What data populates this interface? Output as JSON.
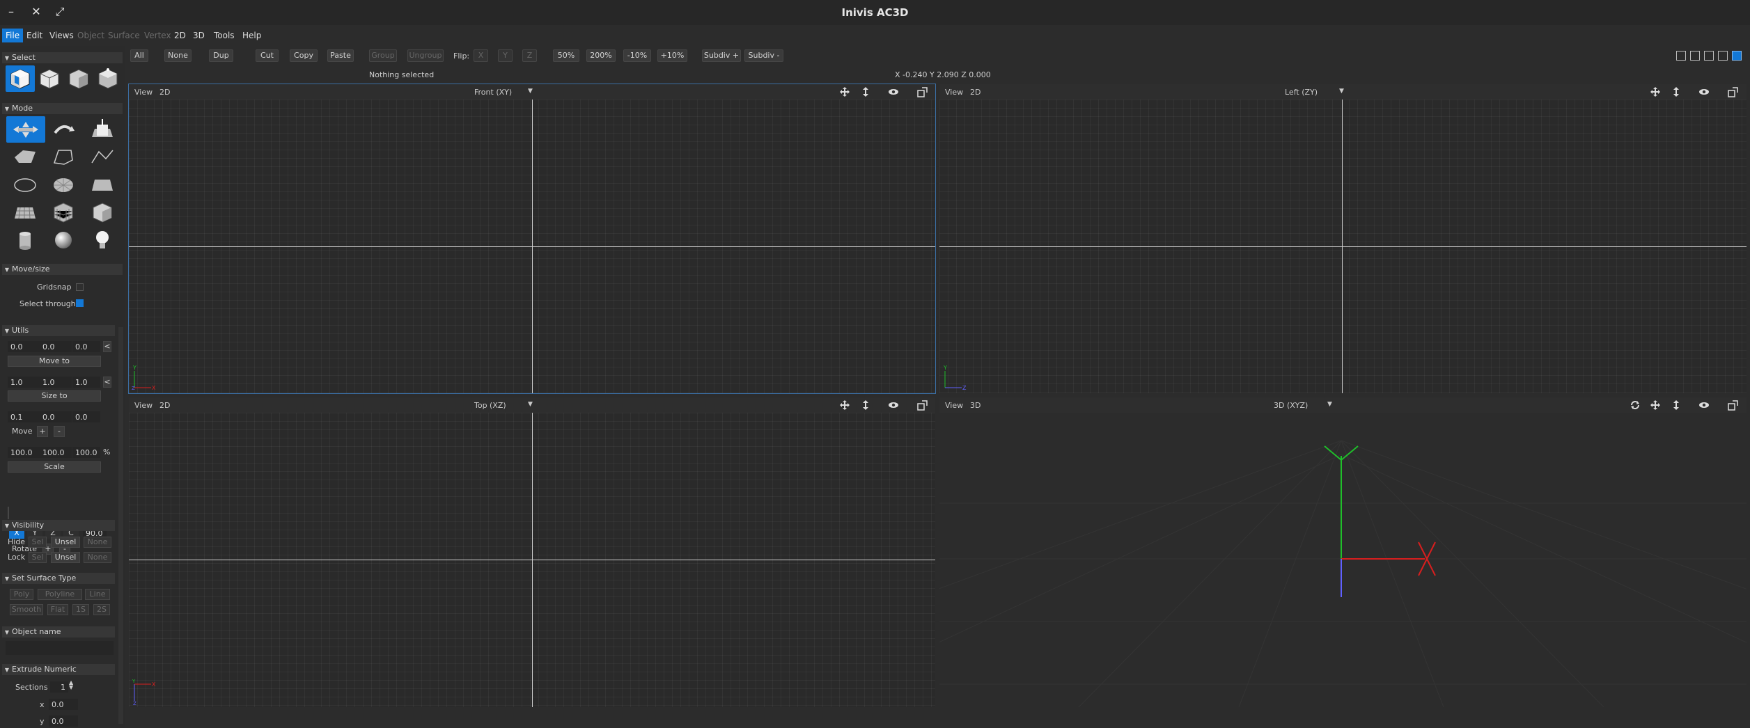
{
  "window": {
    "title": "Inivis AC3D",
    "minimize": "–",
    "close": "✕",
    "maximize": "⤢"
  },
  "menu": {
    "items": [
      {
        "label": "File",
        "state": "active"
      },
      {
        "label": "Edit",
        "state": "normal"
      },
      {
        "label": "Views",
        "state": "normal"
      },
      {
        "label": "Object",
        "state": "disabled"
      },
      {
        "label": "Surface",
        "state": "disabled"
      },
      {
        "label": "Vertex",
        "state": "disabled"
      },
      {
        "label": "2D",
        "state": "normal"
      },
      {
        "label": "3D",
        "state": "normal"
      },
      {
        "label": "Tools",
        "state": "normal"
      },
      {
        "label": "Help",
        "state": "normal"
      }
    ]
  },
  "toolbar": {
    "all": "All",
    "none": "None",
    "dup": "Dup",
    "cut": "Cut",
    "copy": "Copy",
    "paste": "Paste",
    "group": "Group",
    "ungroup": "Ungroup",
    "flip_label": "Flip:",
    "flip_x": "X",
    "flip_y": "Y",
    "flip_z": "Z",
    "zoom_50": "50%",
    "zoom_200": "200%",
    "zoom_minus10": "-10%",
    "zoom_plus10": "+10%",
    "subdiv_plus": "Subdiv +",
    "subdiv_minus": "Subdiv -"
  },
  "status": {
    "selection": "Nothing selected",
    "coords": "X -0.240 Y 2.090 Z 0.000"
  },
  "left_panel": {
    "select_header": "Select",
    "mode_header": "Mode",
    "movesize": {
      "header": "Move/size",
      "gridsnap": "Gridsnap",
      "gridsnap_checked": false,
      "select_through": "Select through",
      "select_through_checked": true
    },
    "utils": {
      "header": "Utils",
      "move_vals": [
        "0.0",
        "0.0",
        "0.0"
      ],
      "move_to": "Move to",
      "size_vals": [
        "1.0",
        "1.0",
        "1.0"
      ],
      "size_to": "Size to",
      "step_vals": [
        "0.1",
        "0.0",
        "0.0"
      ],
      "move_label": "Move",
      "plus": "+",
      "minus": "-",
      "scale_vals": [
        "100.0",
        "100.0",
        "100.0"
      ],
      "percent": "%",
      "scale": "Scale",
      "axes": [
        "X",
        "Y",
        "Z",
        "C"
      ],
      "rotate_angle": "90.0",
      "rotate_label": "Rotate",
      "arrow": "<"
    },
    "visibility": {
      "header": "Visibility",
      "hide": "Hide",
      "lock": "Lock",
      "sel": "Sel",
      "unsel": "Unsel",
      "none": "None"
    },
    "surface": {
      "header": "Set Surface Type",
      "poly": "Poly",
      "polyline": "Polyline",
      "line": "Line",
      "smooth": "Smooth",
      "flat": "Flat",
      "one_s": "1S",
      "two_s": "2S"
    },
    "object_name": {
      "header": "Object name"
    },
    "extrude": {
      "header": "Extrude Numeric",
      "sections_label": "Sections",
      "sections": "1",
      "x_label": "x",
      "x": "0.0",
      "y_label": "y",
      "y": "0.0"
    }
  },
  "viewports": {
    "front": {
      "view": "View",
      "mode": "2D",
      "name": "Front (XY)"
    },
    "left": {
      "view": "View",
      "mode": "2D",
      "name": "Left (ZY)"
    },
    "top": {
      "view": "View",
      "mode": "2D",
      "name": "Top (XZ)"
    },
    "persp": {
      "view": "View",
      "mode": "3D",
      "name": "3D (XYZ)"
    }
  },
  "colors": {
    "accent": "#1378d6",
    "axis_x": "#d81e1e",
    "axis_y": "#1fbf2a",
    "axis_z": "#6060ff"
  }
}
